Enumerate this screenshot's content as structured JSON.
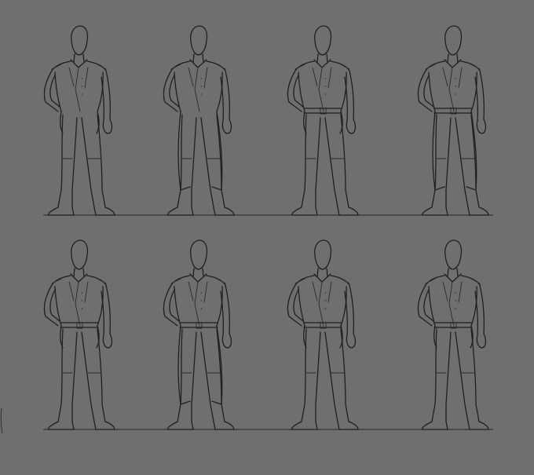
{
  "canvas": {
    "background": "#6f6f6f",
    "line_color": "#1f1f1f"
  },
  "figures": [
    {
      "id": "figure-1",
      "row": 1,
      "column": 1,
      "belt": false,
      "long_coat": false
    },
    {
      "id": "figure-2",
      "row": 1,
      "column": 2,
      "belt": false,
      "long_coat": true
    },
    {
      "id": "figure-3",
      "row": 1,
      "column": 3,
      "belt": true,
      "long_coat": false
    },
    {
      "id": "figure-4",
      "row": 1,
      "column": 4,
      "belt": true,
      "long_coat": true
    },
    {
      "id": "figure-5",
      "row": 2,
      "column": 1,
      "belt": true,
      "long_coat": false
    },
    {
      "id": "figure-6",
      "row": 2,
      "column": 2,
      "belt": true,
      "long_coat": true
    },
    {
      "id": "figure-7",
      "row": 2,
      "column": 3,
      "belt": true,
      "long_coat": false
    },
    {
      "id": "figure-8",
      "row": 2,
      "column": 4,
      "belt": true,
      "long_coat": false
    }
  ]
}
